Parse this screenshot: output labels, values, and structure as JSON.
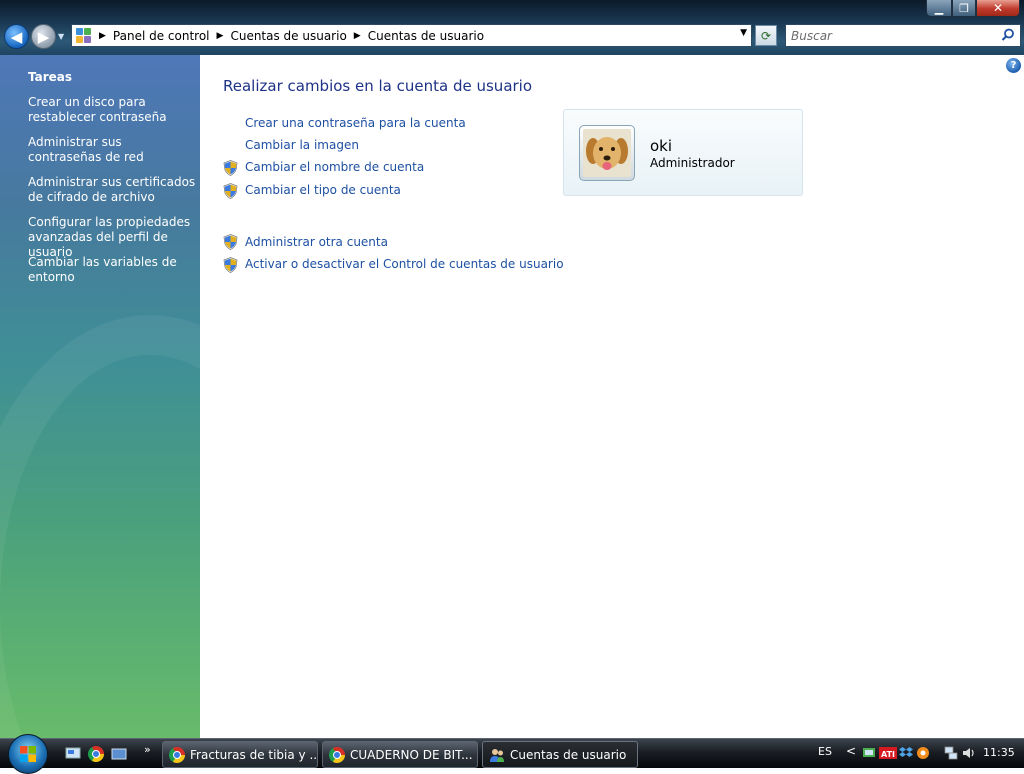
{
  "window": {
    "minimize_label": "▁",
    "maximize_label": "❐",
    "close_label": "✕"
  },
  "address": {
    "crumbs": [
      "Panel de control",
      "Cuentas de usuario",
      "Cuentas de usuario"
    ],
    "search_placeholder": "Buscar"
  },
  "sidebar": {
    "title": "Tareas",
    "items": [
      {
        "label": "Crear un disco para restablecer contraseña"
      },
      {
        "label": "Administrar sus contraseñas de red"
      },
      {
        "label": "Administrar sus certificados de cifrado de archivo"
      },
      {
        "label": "Configurar las propiedades avanzadas del perfil de usuario"
      },
      {
        "label": "Cambiar las variables de entorno"
      }
    ]
  },
  "main": {
    "title": "Realizar cambios en la cuenta de usuario",
    "links": [
      {
        "label": "Crear una contraseña para la cuenta",
        "shield": false
      },
      {
        "label": "Cambiar la imagen",
        "shield": false
      },
      {
        "label": "Cambiar el nombre de cuenta",
        "shield": true
      },
      {
        "label": "Cambiar el tipo de cuenta",
        "shield": true
      }
    ],
    "links2": [
      {
        "label": "Administrar otra cuenta",
        "shield": true
      },
      {
        "label": "Activar o desactivar el Control de cuentas de usuario",
        "shield": true
      }
    ],
    "help_label": "?"
  },
  "user": {
    "name": "oki",
    "role": "Administrador"
  },
  "taskbar": {
    "tasks": [
      {
        "label": "Fracturas de tibia y ...",
        "icon": "chrome-icon"
      },
      {
        "label": "CUADERNO DE BIT...",
        "icon": "chrome-icon"
      },
      {
        "label": "Cuentas de usuario",
        "icon": "user-accounts-icon"
      }
    ],
    "quick_launch_more": "»",
    "tray_arrow": "<",
    "language": "ES",
    "clock": "11:35"
  },
  "colors": {
    "link": "#1e50a2",
    "title": "#1e3287"
  }
}
